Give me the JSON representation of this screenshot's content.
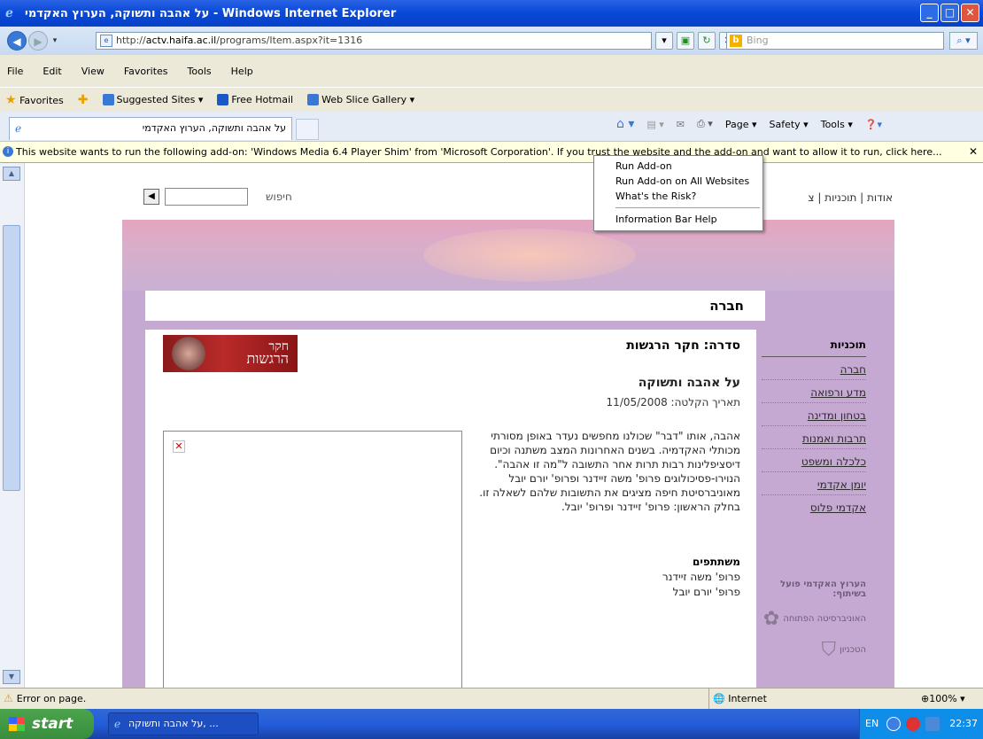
{
  "window": {
    "title": "על אהבה ותשוקה, הערוץ האקדמי - Windows Internet Explorer"
  },
  "address": {
    "url_prefix": "http://",
    "url_domain": "actv.haifa.ac.il",
    "url_path": "/programs/Item.aspx?it=1316",
    "search_placeholder": "Bing"
  },
  "menu": [
    "File",
    "Edit",
    "View",
    "Favorites",
    "Tools",
    "Help"
  ],
  "favorites": {
    "label": "Favorites",
    "items": [
      "Suggested Sites ▾",
      "Free Hotmail",
      "Web Slice Gallery ▾"
    ]
  },
  "tab": {
    "title": "על אהבה ותשוקה, הערוץ האקדמי"
  },
  "commands": [
    "Page ▾",
    "Safety ▾",
    "Tools ▾"
  ],
  "infobar": {
    "text": "This website wants to run the following add-on: 'Windows Media 6.4 Player Shim' from 'Microsoft Corporation'. If you trust the website and the add-on and want to allow it to run, click here..."
  },
  "popup": [
    "Run Add-on",
    "Run Add-on on All Websites",
    "What's the Risk?",
    "Information Bar Help"
  ],
  "site": {
    "search_label": "חיפוש",
    "nav": "אודות | תוכניות | צ",
    "category": "חברה",
    "series": "סדרה: חקר הרגשות",
    "badge_line1": "חקר",
    "badge_line2": "הרגשות",
    "program_title": "על אהבה ותשוקה",
    "record_date": "תאריך הקלטה: 11/05/2008",
    "description": "אהבה, אותו \"דבר\" שכולנו מחפשים נעדר באופן מסורתי מכותלי האקדמיה. בשנים האחרונות המצב משתנה וכיום דיסציפלינות רבות תרות אחר התשובה ל\"מה זו אהבה\". הנוירו-פסיכולוגים פרופ' משה זיידנר ופרופ' יורם יובל מאוניברסיטת חיפה מציגים את התשובות שלהם לשאלה זו. בחלק הראשון: פרופ' זיידנר ופרופ' יובל.",
    "participants_label": "משתתפים",
    "participants": [
      "פרופ' משה זיידנר",
      "פרופ' יורם יובל"
    ],
    "sidebar_heading": "תוכניות",
    "sidebar_items": [
      "חברה",
      "מדע ורפואה",
      "בטחון ומדינה",
      "תרבות ואמנות",
      "כלכלה ומשפט",
      "יומן אקדמי",
      "אקדמי פלוס"
    ],
    "partners_label": "הערוץ האקדמי פועל בשיתוף:",
    "partners": [
      "האוניברסיטה הפתוחה",
      "הטכניון"
    ]
  },
  "status": {
    "error": "Error on page.",
    "zone": "Internet",
    "zoom": "100%"
  },
  "taskbar": {
    "start": "start",
    "item": "על אהבה ותשוקה, ...",
    "lang": "EN",
    "clock": "22:37"
  }
}
